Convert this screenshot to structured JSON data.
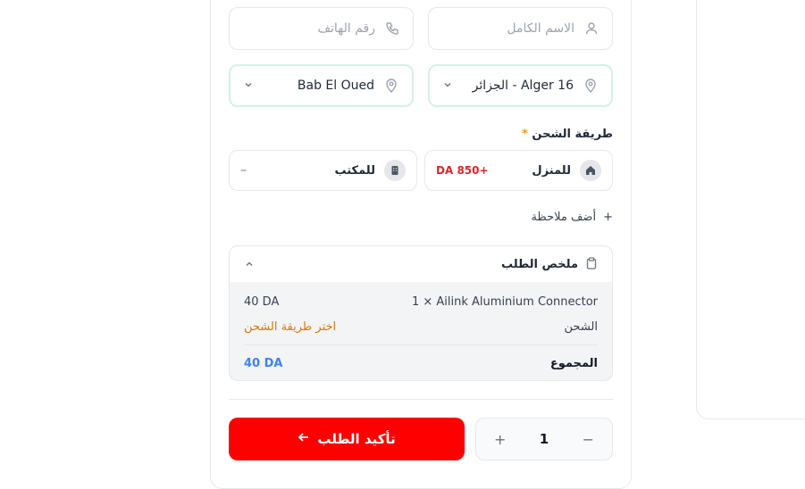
{
  "form": {
    "name_placeholder": "الاسم الكامل",
    "phone_placeholder": "رقم الهاتف",
    "wilaya_value": "16 Alger - الجزائر",
    "commune_value": "Bab El Oued"
  },
  "shipping": {
    "label": "طريقة الشحن",
    "required_mark": "*",
    "home_label": "للمنزل",
    "home_price": "+850 DA",
    "office_label": "للمكتب",
    "office_price": "–"
  },
  "note": {
    "label": "أضف ملاحظة",
    "icon": "+"
  },
  "summary": {
    "title": "ملخص الطلب",
    "item_label": "1 × Ailink Aluminium Connector",
    "item_price": "40 DA",
    "shipping_label": "الشحن",
    "shipping_value": "اختر طريقة الشحن",
    "total_label": "المجموع",
    "total_value": "40 DA"
  },
  "actions": {
    "confirm_label": "تأكيد الطلب",
    "quantity": "1",
    "minus": "−",
    "plus": "+"
  },
  "colors": {
    "accent": "#ff0000",
    "total": "#3b82f6",
    "price": "#dc2626",
    "warn": "#d97706"
  }
}
